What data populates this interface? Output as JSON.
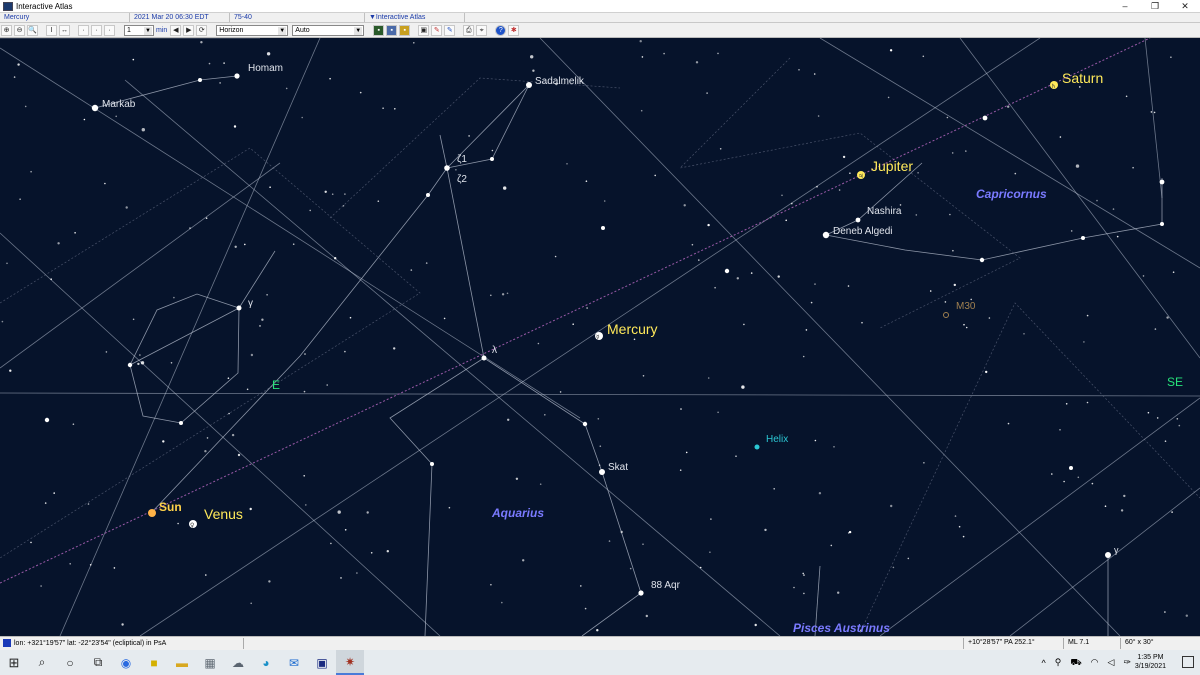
{
  "window": {
    "title": "Interactive Atlas",
    "minimize": "–",
    "maximize": "❐",
    "close": "✕"
  },
  "status_row": {
    "object": "Mercury",
    "datetime": "2021 Mar 20   06:30  EDT",
    "location": "75-40",
    "mode": "▼Interactive Atlas"
  },
  "toolbar": {
    "zoom_in_icon": "⊕",
    "zoom_out_icon": "⊖",
    "zoom_icon": "🔍",
    "step_value": "1",
    "step_unit": "min",
    "prev_icon": "◀",
    "next_icon": "▶",
    "orientation_select": "Horizon",
    "ml_select": "Auto"
  },
  "sky": {
    "labels": {
      "homam": "Homam",
      "markab": "Markab",
      "sadalmelik": "Sadalmelik",
      "zeta1": "ζ1",
      "zeta2": "ζ2",
      "gamma_aqr": "γ",
      "lambda": "λ",
      "nashira": "Nashira",
      "deneb_algedi": "Deneb Algedi",
      "capricornus": "Capricornus",
      "m30": "M30",
      "e": "E",
      "se": "SE",
      "helix": "Helix",
      "skat": "Skat",
      "aquarius": "Aquarius",
      "aqr88": "88 Aqr",
      "pisces_austrinus": "Pisces Austrinus",
      "gamma_gru": "γ"
    },
    "planets": {
      "saturn": "Saturn",
      "jupiter": "Jupiter",
      "mercury": "Mercury",
      "sun": "Sun",
      "venus": "Venus"
    },
    "colors": {
      "sky": "#06132b",
      "planet_label": "#ffe95a",
      "constellation": "#7a7aff",
      "horizon_label": "#27e37a",
      "helix": "#2bc7d4",
      "ecliptic": "#9a5aa8"
    }
  },
  "bottom": {
    "coords": "lon: +321°19'57\"  lat: -22°23'54\" (ecliptical) in PsA",
    "pa": "+10°28'57\" PA 252.1°",
    "ml": "ML 7.1",
    "fov": "60° x 30°"
  },
  "taskbar": {
    "time": "1:35 PM",
    "date": "3/19/2021"
  }
}
